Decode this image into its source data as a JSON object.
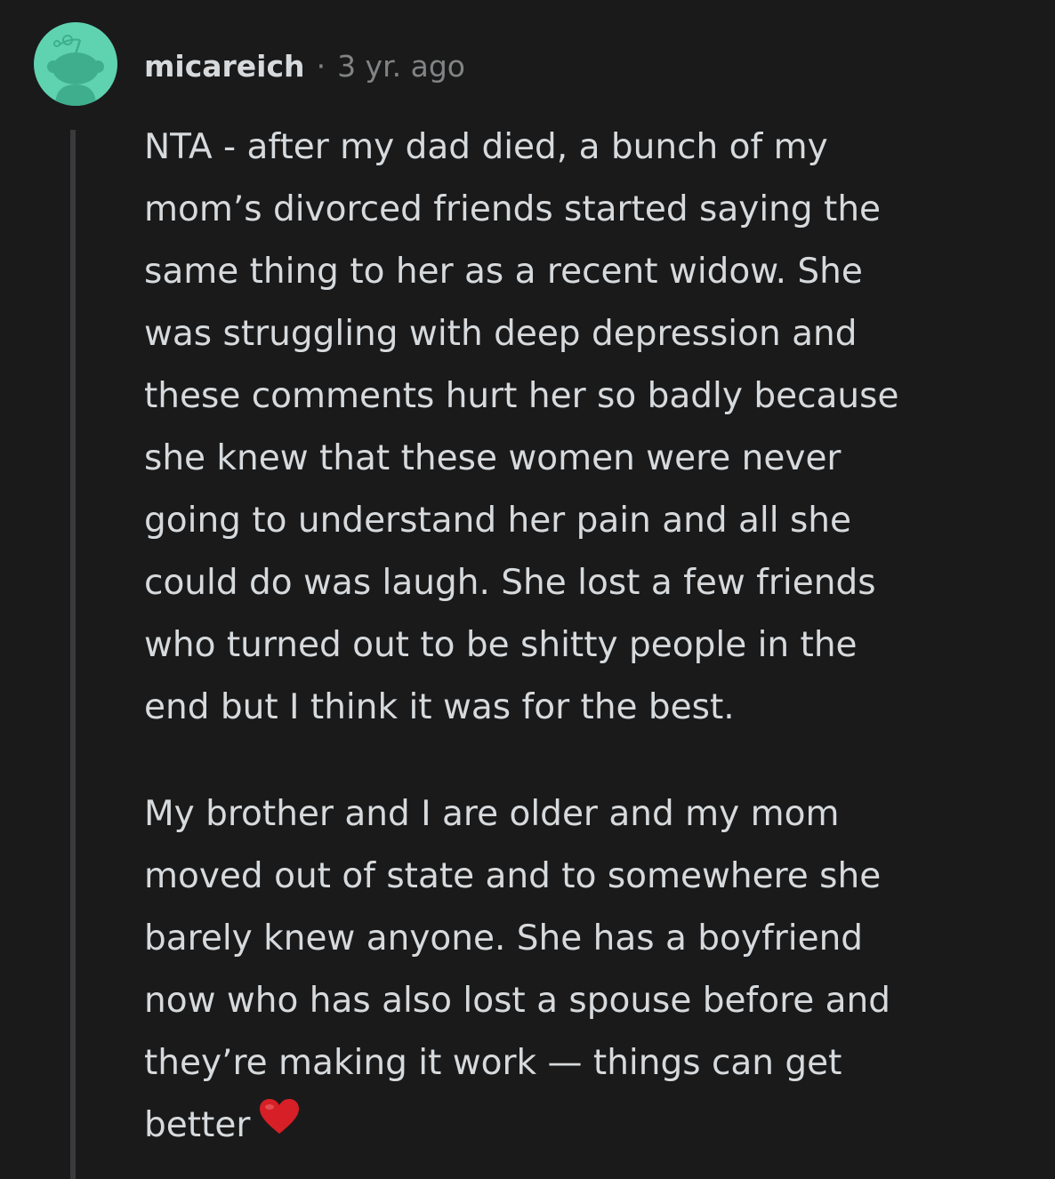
{
  "comment": {
    "username": "micareich",
    "separator": "·",
    "time": "3 yr. ago",
    "avatar_icon": "reddit-snoo-avatar",
    "avatar_color": "#5fd3b0",
    "paragraphs": [
      [
        "NTA - after my dad died, a bunch of my",
        "mom’s divorced friends started saying the",
        "same thing to her as a recent widow. She",
        "was struggling with deep depression and",
        "these comments hurt her so badly because",
        "she knew that these women were never",
        "going to understand her pain and all she",
        "could do was laugh. She lost a few friends",
        "who turned out to be shitty people in the",
        "end but I think it was for the best."
      ],
      [
        "My brother and I are older and my mom",
        "moved out of state and to somewhere she",
        "barely knew anyone. She has a boyfriend",
        "now who has also lost a spouse before and",
        "they’re making it work — things can get",
        "better"
      ]
    ],
    "emoji": "heart-emoji",
    "emoji_color": "#d61f26"
  },
  "colors": {
    "background": "#1a1a1b",
    "text": "#d7dadc",
    "meta": "#818384",
    "thread_line": "#3a3a3c"
  }
}
